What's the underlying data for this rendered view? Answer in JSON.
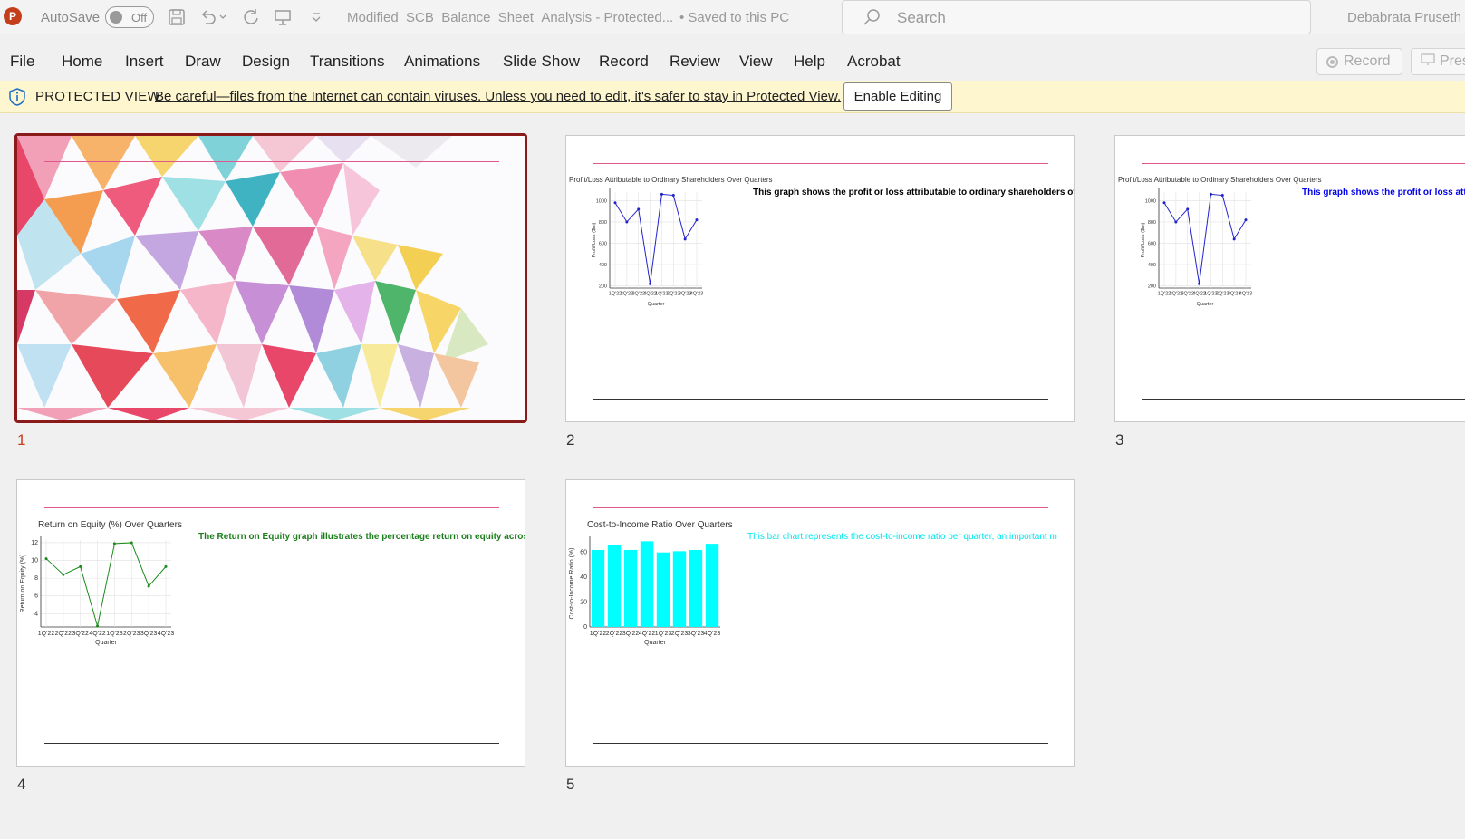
{
  "titlebar": {
    "app_icon": "P",
    "autosave_label": "AutoSave",
    "autosave_state": "Off",
    "doc_title": "Modified_SCB_Balance_Sheet_Analysis  -  Protected...",
    "saved_status": "• Saved to this PC",
    "search_placeholder": "Search",
    "user_name": "Debabrata Pruseth"
  },
  "menu": {
    "items": [
      "File",
      "Home",
      "Insert",
      "Draw",
      "Design",
      "Transitions",
      "Animations",
      "Slide Show",
      "Record",
      "Review",
      "View",
      "Help",
      "Acrobat"
    ],
    "record_label": "Record",
    "present_label": "Pres"
  },
  "protected_view": {
    "label": "PROTECTED VIEW",
    "message": "Be careful—files from the Internet can contain viruses. Unless you need to edit, it's safer to stay in Protected View.",
    "enable_button": "Enable Editing"
  },
  "slides": [
    {
      "number": "1"
    },
    {
      "number": "2",
      "chart_title": "Profit/Loss Attributable to Ordinary Shareholders Over Quarters",
      "caption": "This graph shows the profit or loss attributable to ordinary shareholders over",
      "caption_color": "#000000"
    },
    {
      "number": "3",
      "chart_title": "Profit/Loss Attributable to Ordinary Shareholders Over Quarters",
      "caption": "This graph shows the profit or loss attributable to ordinary",
      "caption_color": "#0000ee"
    },
    {
      "number": "4",
      "chart_title": "Return on Equity (%) Over Quarters",
      "caption": "The Return on Equity graph illustrates the percentage return on equity across",
      "caption_color": "#1a7f1a"
    },
    {
      "number": "5",
      "chart_title": "Cost-to-Income Ratio Over Quarters",
      "caption": "This bar chart represents the cost-to-income ratio per quarter, an important m",
      "caption_color": "#00e5ee"
    }
  ],
  "chart_data": [
    {
      "type": "line",
      "title": "Profit/Loss Attributable to Ordinary Shareholders Over Quarters",
      "xlabel": "Quarter",
      "ylabel": "Profit/Loss ($m)",
      "categories": [
        "1Q'22",
        "2Q'22",
        "3Q'22",
        "4Q'22",
        "1Q'23",
        "2Q'23",
        "3Q'23",
        "4Q'23"
      ],
      "values": [
        980,
        800,
        920,
        220,
        1060,
        1050,
        640,
        820
      ],
      "yticks": [
        200,
        400,
        600,
        800,
        1000
      ],
      "ylim": [
        180,
        1080
      ],
      "color": "#2222cc"
    },
    {
      "type": "line",
      "title": "Profit/Loss Attributable to Ordinary Shareholders Over Quarters",
      "xlabel": "Quarter",
      "ylabel": "Profit/Loss ($m)",
      "categories": [
        "1Q'22",
        "2Q'22",
        "3Q'22",
        "4Q'22",
        "1Q'23",
        "2Q'23",
        "3Q'23",
        "4Q'23"
      ],
      "values": [
        980,
        800,
        920,
        220,
        1060,
        1050,
        640,
        820
      ],
      "yticks": [
        200,
        400,
        600,
        800,
        1000
      ],
      "ylim": [
        180,
        1080
      ],
      "color": "#2222cc"
    },
    {
      "type": "line",
      "title": "Return on Equity (%) Over Quarters",
      "xlabel": "Quarter",
      "ylabel": "Return on Equity (%)",
      "categories": [
        "1Q'22",
        "2Q'22",
        "3Q'22",
        "4Q'22",
        "1Q'23",
        "2Q'23",
        "3Q'23",
        "4Q'23"
      ],
      "values": [
        10.2,
        8.4,
        9.3,
        2.6,
        11.9,
        12.0,
        7.1,
        9.3
      ],
      "yticks": [
        4,
        6,
        8,
        10,
        12
      ],
      "ylim": [
        2.5,
        12.3
      ],
      "color": "#1a8a1a"
    },
    {
      "type": "bar",
      "title": "Cost-to-Income Ratio Over Quarters",
      "xlabel": "Quarter",
      "ylabel": "Cost-to-Income Ratio (%)",
      "categories": [
        "1Q'22",
        "2Q'22",
        "3Q'22",
        "4Q'22",
        "1Q'23",
        "2Q'23",
        "3Q'23",
        "4Q'23"
      ],
      "values": [
        62,
        66,
        62,
        69,
        60,
        61,
        62,
        67
      ],
      "yticks": [
        0,
        20,
        40,
        60
      ],
      "ylim": [
        0,
        70
      ],
      "color": "#00ffff"
    }
  ]
}
